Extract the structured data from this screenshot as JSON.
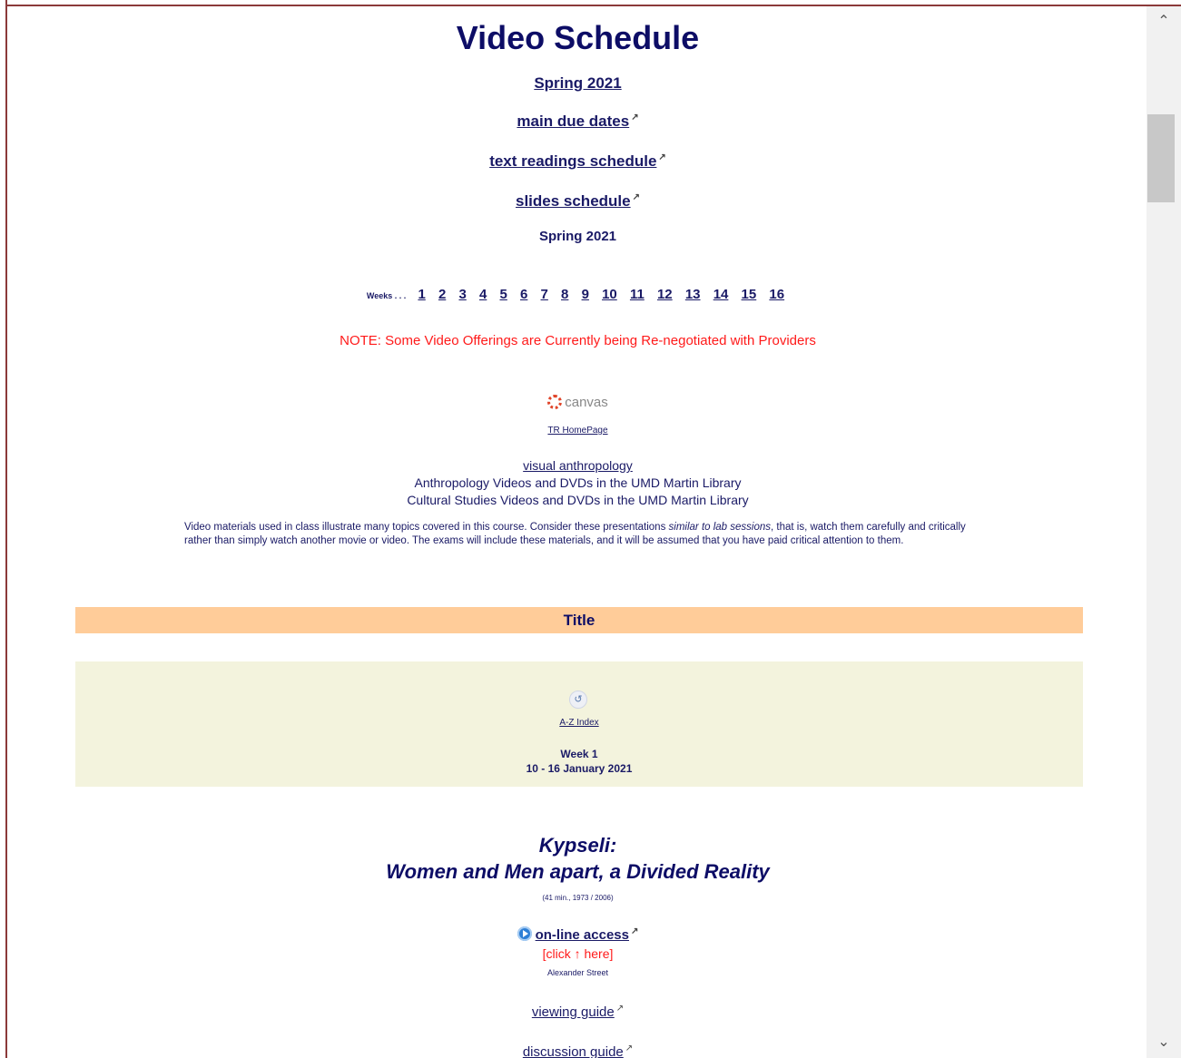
{
  "page": {
    "title": "Video Schedule",
    "links": {
      "semester": "Spring 2021",
      "main_due_dates": "main due dates",
      "text_readings": "text readings schedule",
      "slides": "slides schedule"
    },
    "semester_label": "Spring 2021",
    "weeks_lead": "Weeks . . .",
    "weeks": [
      "1",
      "2",
      "3",
      "4",
      "5",
      "6",
      "7",
      "8",
      "9",
      "10",
      "11",
      "12",
      "13",
      "14",
      "15",
      "16"
    ],
    "note": "NOTE: Some Video Offerings are Currently being Re-negotiated with Providers",
    "canvas_label": "canvas",
    "tr_homepage": "TR HomePage",
    "resources": {
      "visual_anthropology": "visual anthropology",
      "anthropology_videos": "Anthropology Videos and DVDs in the UMD Martin Library",
      "cultural_studies_videos": "Cultural Studies Videos and DVDs in the UMD Martin Library"
    },
    "description": {
      "part1": "Video materials used in class illustrate many topics covered in this course. Consider these presentations ",
      "emphasis": "similar to lab sessions",
      "part2": ", that is, watch them carefully and critically rather than simply watch another movie or video. The exams will include these materials, and it will be assumed that you have paid critical attention to them."
    },
    "table_header": "Title",
    "week_block": {
      "az_index": "A-Z Index",
      "week": "Week 1",
      "dates": "10 - 16 January 2021"
    },
    "film": {
      "title_line1": "Kypseli:",
      "title_line2": "Women and Men apart, a Divided Reality",
      "meta": "(41 min., 1973 / 2006)",
      "online_access": "on-line access",
      "click_here": "[click ↑ here]",
      "provider": "Alexander Street",
      "viewing_guide": "viewing guide",
      "discussion_guide": "discussion guide"
    }
  },
  "icons": {
    "external_link": "external-link-icon",
    "play": "play-icon",
    "canvas_logo": "canvas-logo-icon",
    "az_index": "refresh-icon",
    "scroll_up": "chevron-up-icon",
    "scroll_down": "chevron-down-icon"
  },
  "colors": {
    "link": "#1a1a66",
    "note": "#ff1a1a",
    "title_bar": "#ffcc99",
    "week_box": "#f3f3dd"
  }
}
